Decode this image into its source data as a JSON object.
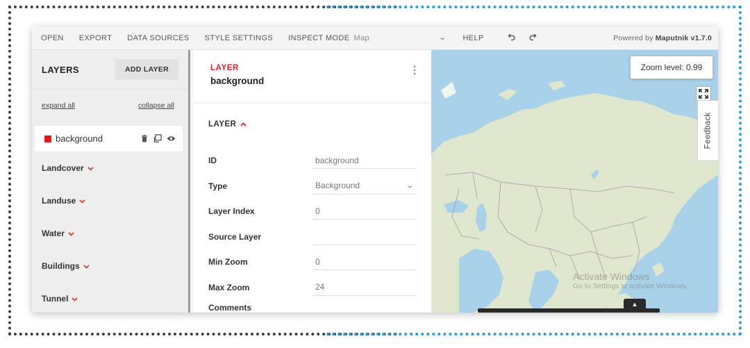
{
  "toolbar": {
    "items": [
      "OPEN",
      "EXPORT",
      "DATA SOURCES",
      "STYLE SETTINGS",
      "INSPECT MODE"
    ],
    "inspect_value": "Map",
    "help": "HELP",
    "powered_prefix": "Powered by ",
    "powered_brand": "Maputnik v1.7.0"
  },
  "layers": {
    "title": "LAYERS",
    "add_button": "ADD LAYER",
    "expand_all": "expand all",
    "collapse_all": "collapse all",
    "active_layer": {
      "name": "background",
      "color": "#e2161c"
    },
    "groups": [
      "Landcover",
      "Landuse",
      "Water",
      "Buildings",
      "Tunnel"
    ]
  },
  "editor": {
    "kicker": "LAYER",
    "title": "background",
    "section": "LAYER",
    "properties": [
      {
        "label": "ID",
        "value": "background"
      },
      {
        "label": "Type",
        "value": "Background"
      },
      {
        "label": "Layer Index",
        "value": "0"
      },
      {
        "label": "Source Layer",
        "value": ""
      },
      {
        "label": "Min Zoom",
        "value": "0"
      },
      {
        "label": "Max Zoom",
        "value": "24"
      }
    ],
    "cut_label": "Comments"
  },
  "map": {
    "zoom_text": "Zoom level: 0.99",
    "feedback": "Feedback",
    "watermark_title": "Activate Windows",
    "watermark_sub": "Go to Settings to activate Windows."
  },
  "colors": {
    "accent": "#d0202b",
    "water": "#a9d1ea",
    "land": "#dfe8cf"
  }
}
